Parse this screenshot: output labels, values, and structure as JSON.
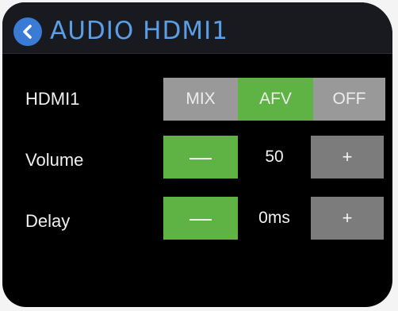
{
  "header": {
    "title": "AUDIO HDMI1",
    "back_icon": "chevron-left-icon",
    "accent_color": "#3a7bd5"
  },
  "hdmi1": {
    "label": "HDMI1",
    "options": [
      "MIX",
      "AFV",
      "OFF"
    ],
    "selected": "AFV",
    "active_color": "#5fb244",
    "inactive_color": "#999999"
  },
  "volume": {
    "label": "Volume",
    "decrease_label": "—",
    "value": "50",
    "increase_label": "+"
  },
  "delay": {
    "label": "Delay",
    "decrease_label": "—",
    "value": "0ms",
    "increase_label": "+"
  }
}
